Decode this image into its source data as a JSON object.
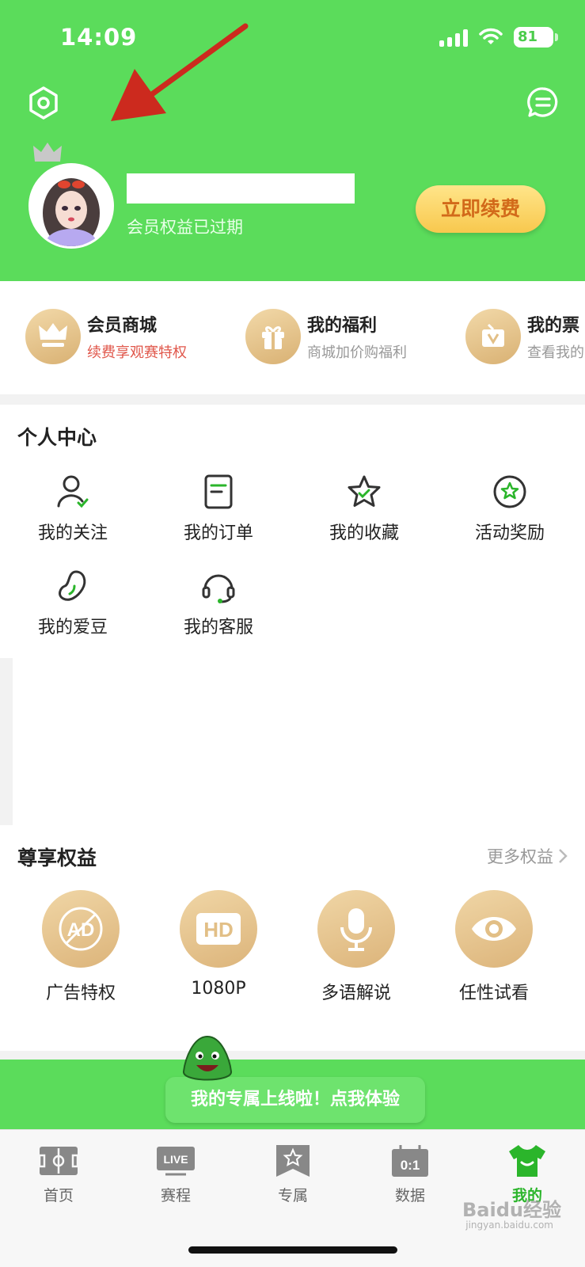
{
  "status_bar": {
    "time": "14:09",
    "battery": "81"
  },
  "profile": {
    "status_text": "会员权益已过期",
    "renew_label": "立即续费"
  },
  "member_items": [
    {
      "title": "会员商城",
      "subtitle": "续费享观赛特权"
    },
    {
      "title": "我的福利",
      "subtitle": "商城加价购福利"
    },
    {
      "title": "我的票",
      "subtitle": "查看我的"
    }
  ],
  "personal_center": {
    "title": "个人中心",
    "items": [
      "我的关注",
      "我的订单",
      "我的收藏",
      "活动奖励",
      "我的爱豆",
      "我的客服"
    ]
  },
  "privileges": {
    "title": "尊享权益",
    "more_label": "更多权益",
    "items": [
      "广告特权",
      "1080P",
      "多语解说",
      "任性试看"
    ],
    "icon_texts": [
      "AD",
      "HD"
    ]
  },
  "banner": {
    "text": "我的专属上线啦！点我体验"
  },
  "tabbar": {
    "items": [
      "首页",
      "赛程",
      "专属",
      "数据",
      "我的"
    ],
    "live_text": "LIVE",
    "score_text": "0:1"
  },
  "watermark": {
    "main": "Baidu经验",
    "sub": "jingyan.baidu.com"
  },
  "colors": {
    "brand_green": "#5bdc5b",
    "gold": "#dcb47a",
    "accent_red": "#e0564a",
    "renew_text": "#d26a1a"
  }
}
